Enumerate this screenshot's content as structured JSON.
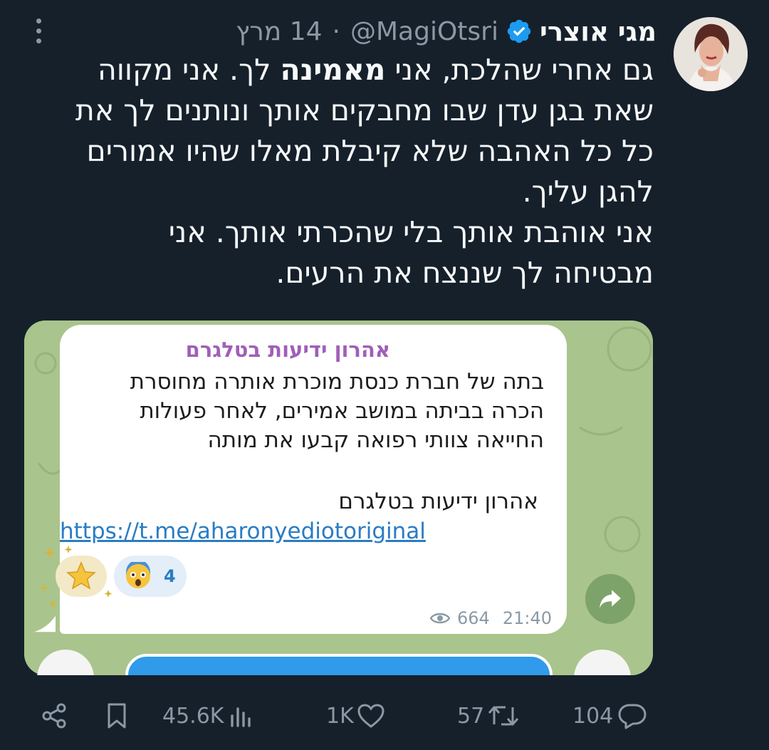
{
  "author": {
    "display_name": "מגי אוצרי",
    "handle": "@MagiOtsri",
    "separator": "·",
    "date": "14 מרץ",
    "verified": true
  },
  "tweet": {
    "line1_a": "גם אחרי שהלכת, אני ",
    "line1_bold": "מאמינה",
    "line1_b": " לך. אני מקווה",
    "line2": "שאת בגן עדן שבו מחבקים אותך ונותנים לך את",
    "line3": "כל כל האהבה שלא קיבלת מאלו שהיו אמורים",
    "line4": "להגן עליך.",
    "line5": "אני אוהבת אותך בלי שהכרתי אותך. אני",
    "line6": "מבטיחה לך שננצח את הרעים."
  },
  "telegram": {
    "channel": "אהרון ידיעות בטלגרם",
    "text_line1": "בתה של חברת כנסת מוכרת אותרה מחוסרת",
    "text_line2": "הכרה בביתה במושב אמירים, לאחר פעולות",
    "text_line3": "החייאה צוותי רפואה קבעו את מותה",
    "signature": "אהרון ידיעות בטלגרם",
    "link": "https://t.me/aharonyediotoriginal",
    "reaction_count": "4",
    "views": "664",
    "time": "21:40"
  },
  "actions": {
    "views": "45.6K",
    "likes": "1K",
    "retweets": "57",
    "replies": "104"
  },
  "colors": {
    "background": "#15202b",
    "text": "#f7f9f9",
    "muted": "#8b98a5",
    "verified": "#1d9bf0",
    "telegram_link": "#2a7cc4",
    "channel_name": "#a05fb8"
  },
  "icons": [
    "more-icon",
    "verified-icon",
    "eye-icon",
    "share-arrow-icon",
    "share-icon",
    "bookmark-icon",
    "views-icon",
    "like-icon",
    "retweet-icon",
    "reply-icon"
  ]
}
